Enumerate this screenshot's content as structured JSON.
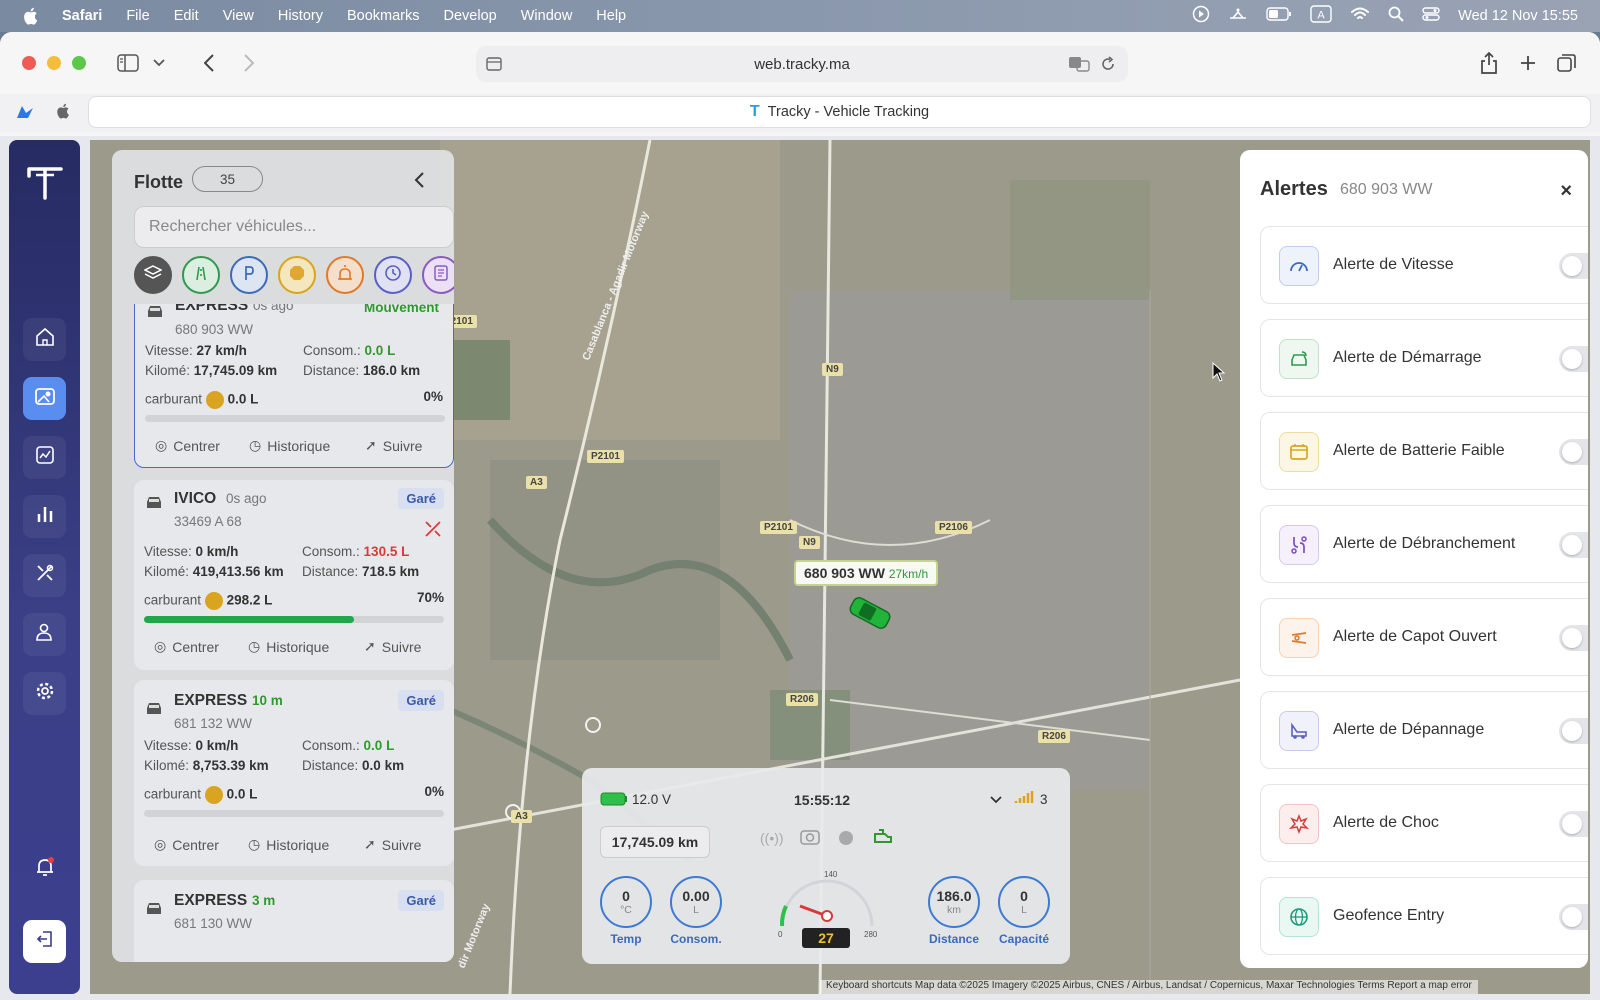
{
  "menubar": {
    "app_name": "Safari",
    "items": [
      "File",
      "Edit",
      "View",
      "History",
      "Bookmarks",
      "Develop",
      "Window",
      "Help"
    ],
    "datetime": "Wed 12 Nov  15:55"
  },
  "browser": {
    "url": "web.tracky.ma",
    "tab_title": "Tracky - Vehicle Tracking"
  },
  "fleet": {
    "title": "Flotte",
    "count": "35",
    "search_placeholder": "Rechercher véhicules...",
    "vehicles": [
      {
        "name": "EXPRESS",
        "ago": "0s ago",
        "plate": "680 903 WW",
        "status": "Mouvement",
        "speed_label": "Vitesse:",
        "speed": "27 km/h",
        "consom_label": "Consom.:",
        "consom": "0.0 L",
        "km_label": "Kilomé:",
        "km": "17,745.09 km",
        "dist_label": "Distance:",
        "dist": "186.0 km",
        "fuel_label": "carburant",
        "fuel": "0.0 L",
        "fuel_pct": "0%",
        "fuel_level": 0
      },
      {
        "name": "IVICO",
        "ago": "0s ago",
        "plate": "33469 A 68",
        "status": "Garé",
        "speed_label": "Vitesse:",
        "speed": "0 km/h",
        "consom_label": "Consom.:",
        "consom": "130.5 L",
        "km_label": "Kilomé:",
        "km": "419,413.56 km",
        "dist_label": "Distance:",
        "dist": "718.5 km",
        "fuel_label": "carburant",
        "fuel": "298.2 L",
        "fuel_pct": "70%",
        "fuel_level": 70
      },
      {
        "name": "EXPRESS",
        "ago": "10 m",
        "plate": "681 132 WW",
        "status": "Garé",
        "speed_label": "Vitesse:",
        "speed": "0 km/h",
        "consom_label": "Consom.:",
        "consom": "0.0 L",
        "km_label": "Kilomé:",
        "km": "8,753.39 km",
        "dist_label": "Distance:",
        "dist": "0.0 km",
        "fuel_label": "carburant",
        "fuel": "0.0 L",
        "fuel_pct": "0%",
        "fuel_level": 0
      },
      {
        "name": "EXPRESS",
        "ago": "3 m",
        "plate": "681 130 WW",
        "status": "Garé"
      }
    ],
    "actions": {
      "center": "Centrer",
      "history": "Historique",
      "follow": "Suivre"
    }
  },
  "map": {
    "marker_plate": "680 903 WW",
    "marker_speed": "27km/h",
    "roads": [
      "P2101",
      "P2101",
      "P2101",
      "P2106",
      "N9",
      "N9",
      "A3",
      "A3",
      "R206",
      "R206"
    ],
    "road_names": [
      "Casablanca - Agadir Motorway",
      "dir Motorway"
    ],
    "credits": "Keyboard shortcuts    Map data ©2025 Imagery ©2025 Airbus, CNES / Airbus, Landsat / Copernicus, Maxar Technologies    Terms    Report a map error"
  },
  "dashboard": {
    "battery": "12.0 V",
    "time": "15:55:12",
    "signal": "3",
    "odometer": "17,745.09 km",
    "speed": "27",
    "gauge_max": "280",
    "gauge_mid": "140",
    "gauge_min": "0",
    "circles": [
      {
        "value": "0",
        "unit": "°C",
        "label": "Temp"
      },
      {
        "value": "0.00",
        "unit": "L",
        "label": "Consom."
      },
      {
        "value": "186.0",
        "unit": "km",
        "label": "Distance"
      },
      {
        "value": "0",
        "unit": "L",
        "label": "Capacité"
      }
    ]
  },
  "alerts": {
    "title": "Alertes",
    "plate": "680 903 WW",
    "items": [
      {
        "label": "Alerte de Vitesse",
        "color": "#3d6ab8",
        "icon": "speedometer-icon",
        "on": false
      },
      {
        "label": "Alerte de Démarrage",
        "color": "#2e9a4e",
        "icon": "car-start-icon",
        "on": false
      },
      {
        "label": "Alerte de Batterie Faible",
        "color": "#d9a520",
        "icon": "battery-icon",
        "on": false
      },
      {
        "label": "Alerte de Débranchement",
        "color": "#7b4fc4",
        "icon": "unplug-icon",
        "on": false
      },
      {
        "label": "Alerte de Capot Ouvert",
        "color": "#e07a2a",
        "icon": "hood-icon",
        "on": false
      },
      {
        "label": "Alerte de Dépannage",
        "color": "#5a5fc4",
        "icon": "tow-truck-icon",
        "on": false
      },
      {
        "label": "Alerte de Choc",
        "color": "#d83a3a",
        "icon": "crash-icon",
        "on": false
      },
      {
        "label": "Geofence Entry",
        "color": "#1a9a7a",
        "icon": "globe-icon",
        "on": false
      }
    ]
  }
}
